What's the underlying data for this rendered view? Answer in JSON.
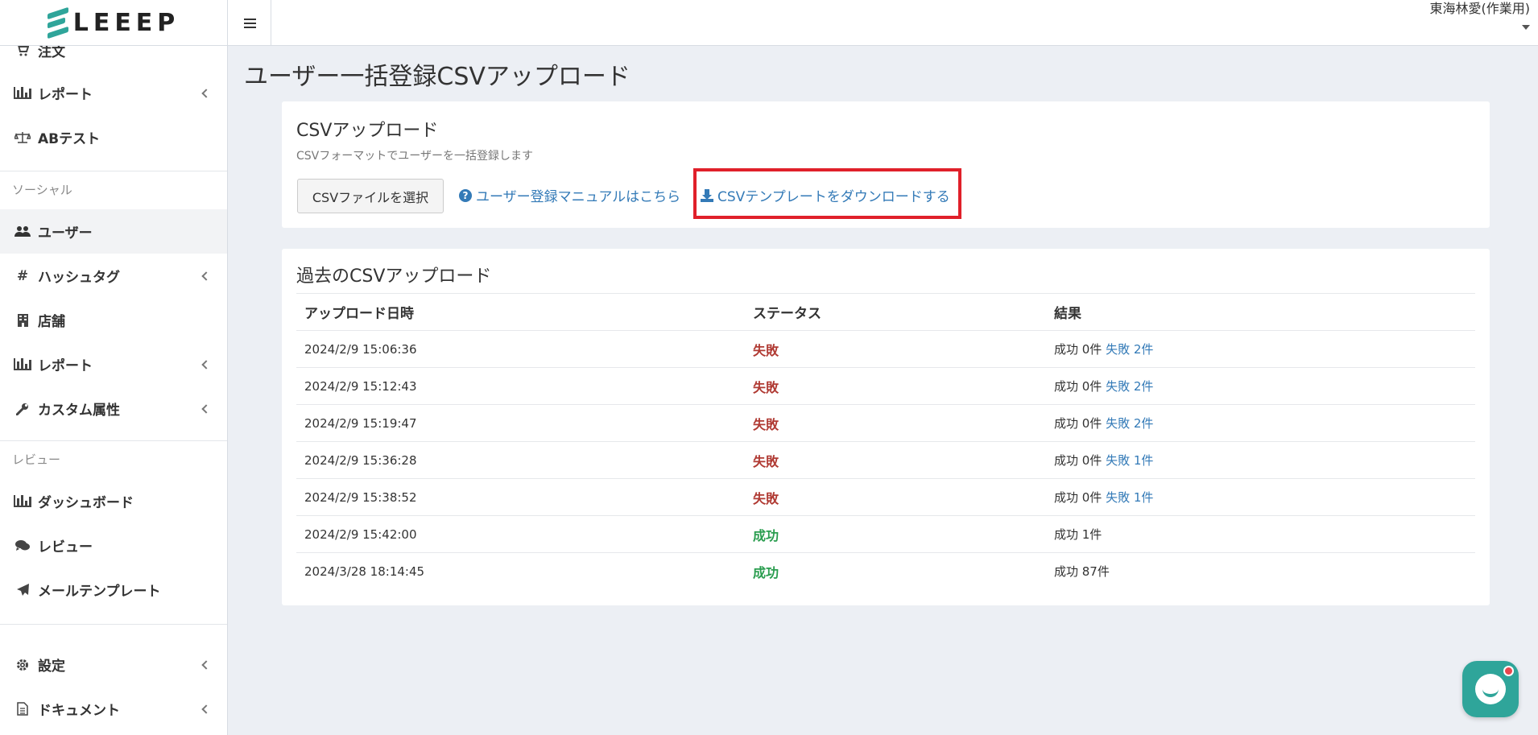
{
  "header": {
    "logo_text": "LEEEP",
    "user_name": "東海林愛(作業用)"
  },
  "sidebar": {
    "items": [
      {
        "label": "注文",
        "icon": "cart-icon"
      },
      {
        "label": "レポート",
        "icon": "bar-chart-icon"
      },
      {
        "label": "ABテスト",
        "icon": "balance-scale-icon"
      },
      {
        "label": "ユーザー",
        "icon": "users-icon"
      },
      {
        "label": "ハッシュタグ",
        "icon": "hashtag-icon"
      },
      {
        "label": "店舗",
        "icon": "building-icon"
      },
      {
        "label": "レポート",
        "icon": "bar-chart-icon"
      },
      {
        "label": "カスタム属性",
        "icon": "wrench-icon"
      },
      {
        "label": "ダッシュボード",
        "icon": "bar-chart-icon"
      },
      {
        "label": "レビュー",
        "icon": "comments-icon"
      },
      {
        "label": "メールテンプレート",
        "icon": "paper-plane-icon"
      },
      {
        "label": "設定",
        "icon": "gear-icon"
      },
      {
        "label": "ドキュメント",
        "icon": "file-icon"
      }
    ],
    "sections": {
      "social": "ソーシャル",
      "review": "レビュー"
    }
  },
  "page": {
    "title": "ユーザー一括登録CSVアップロード"
  },
  "upload_card": {
    "title": "CSVアップロード",
    "description": "CSVフォーマットでユーザーを一括登録します",
    "file_button": "CSVファイルを選択",
    "manual_link": "ユーザー登録マニュアルはこちら",
    "template_link": "CSVテンプレートをダウンロードする"
  },
  "history_card": {
    "title": "過去のCSVアップロード",
    "columns": [
      "アップロード日時",
      "ステータス",
      "結果"
    ],
    "rows": [
      {
        "datetime": "2024/2/9 15:06:36",
        "status": "失敗",
        "ok": false,
        "success": "成功 0件",
        "failed": "失敗 2件"
      },
      {
        "datetime": "2024/2/9 15:12:43",
        "status": "失敗",
        "ok": false,
        "success": "成功 0件",
        "failed": "失敗 2件"
      },
      {
        "datetime": "2024/2/9 15:19:47",
        "status": "失敗",
        "ok": false,
        "success": "成功 0件",
        "failed": "失敗 2件"
      },
      {
        "datetime": "2024/2/9 15:36:28",
        "status": "失敗",
        "ok": false,
        "success": "成功 0件",
        "failed": "失敗 1件"
      },
      {
        "datetime": "2024/2/9 15:38:52",
        "status": "失敗",
        "ok": false,
        "success": "成功 0件",
        "failed": "失敗 1件"
      },
      {
        "datetime": "2024/2/9 15:42:00",
        "status": "成功",
        "ok": true,
        "success": "成功 1件",
        "failed": ""
      },
      {
        "datetime": "2024/3/28 18:14:45",
        "status": "成功",
        "ok": true,
        "success": "成功 87件",
        "failed": ""
      }
    ]
  },
  "colors": {
    "brand": "#2fa59a",
    "link": "#337ab7",
    "fail": "#b03a33",
    "success": "#2a9d4f",
    "highlight": "#e0202a"
  }
}
